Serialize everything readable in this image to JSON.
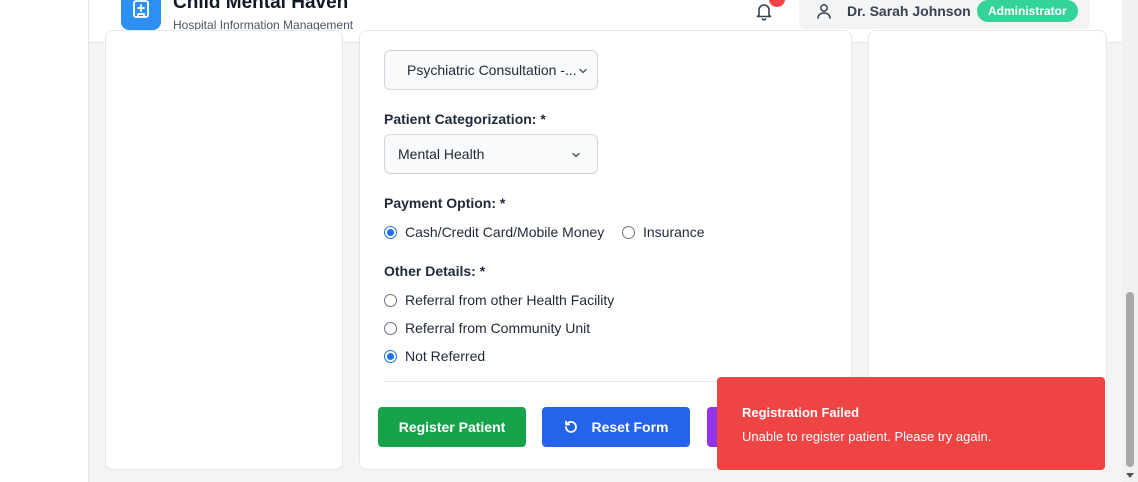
{
  "header": {
    "app_title": "Child Mental Haven",
    "app_subtitle": "Hospital Information Management",
    "user_name": "Dr. Sarah Johnson",
    "user_role": "Administrator"
  },
  "form": {
    "service_select_value": "Psychiatric Consultation -...",
    "categorization_label": "Patient Categorization: *",
    "categorization_value": "Mental Health",
    "payment_label": "Payment Option: *",
    "payment_options": [
      {
        "label": "Cash/Credit Card/Mobile Money",
        "checked": true
      },
      {
        "label": "Insurance",
        "checked": false
      }
    ],
    "other_details_label": "Other Details: *",
    "other_details_options": [
      {
        "label": "Referral from other Health Facility",
        "checked": false
      },
      {
        "label": "Referral from Community Unit",
        "checked": false
      },
      {
        "label": "Not Referred",
        "checked": true
      }
    ],
    "register_button": "Register Patient",
    "reset_button": "Reset Form"
  },
  "toast": {
    "title": "Registration Failed",
    "message": "Unable to register patient. Please try again."
  },
  "colors": {
    "primary_blue": "#2563eb",
    "success_green": "#16a34a",
    "error_red": "#ef4444",
    "badge_green": "#34d399"
  }
}
